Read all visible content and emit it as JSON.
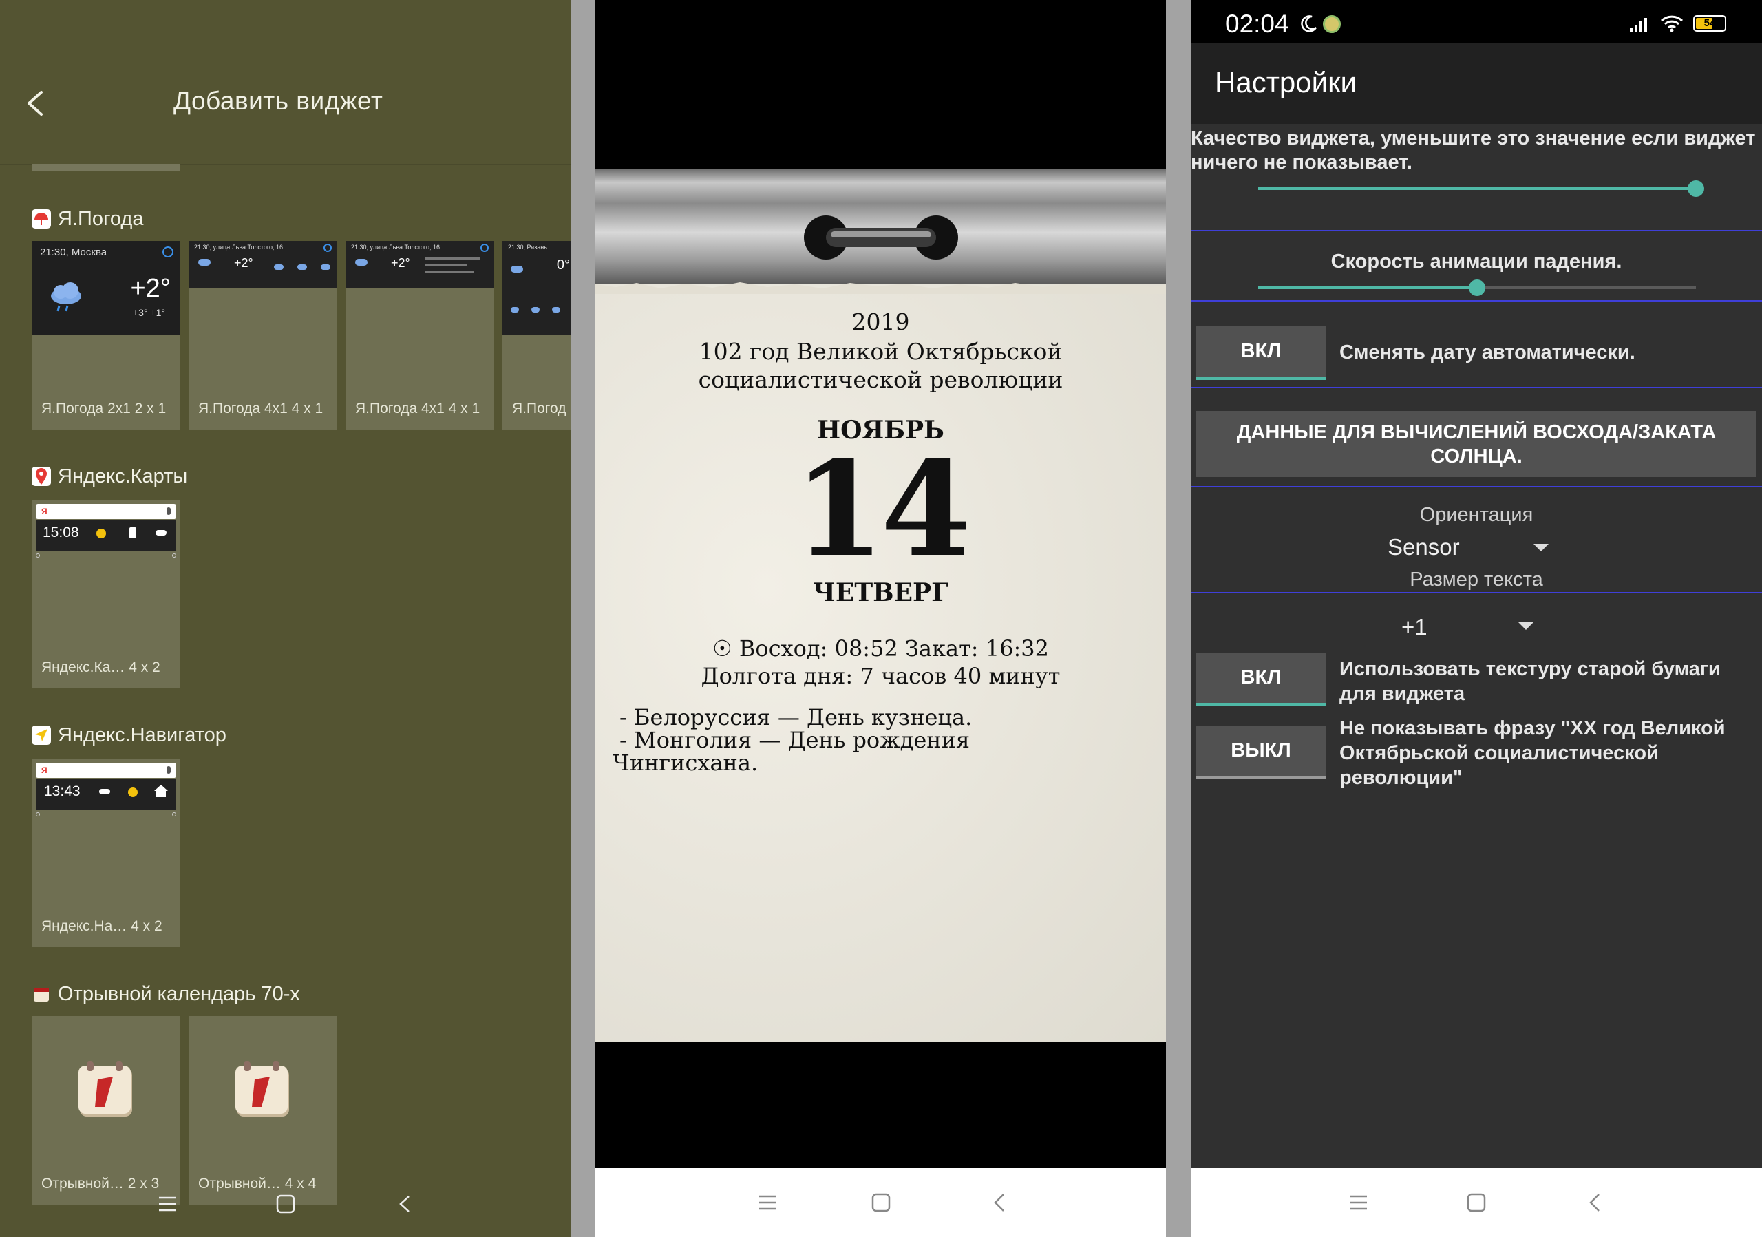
{
  "widget_picker": {
    "title": "Добавить виджет",
    "sections": [
      {
        "label": "Я.Погода",
        "cards": [
          {
            "caption": "Я.Погода 2x1 2 x 1",
            "header": "21:30, Москва",
            "temp": "+2°",
            "minmax": "+3° +1°"
          },
          {
            "caption": "Я.Погода 4x1 4 x 1",
            "header": "21:30, улица Льва Толстого, 16",
            "temp": "+2°"
          },
          {
            "caption": "Я.Погода 4x1 4 x 1",
            "header": "21:30, улица Льва Толстого, 16",
            "temp": "+2°"
          },
          {
            "caption": "Я.Погод",
            "header": "21:30, Рязань",
            "temp": "0°"
          }
        ]
      },
      {
        "label": "Яндекс.Карты",
        "cards": [
          {
            "caption": "Яндекс.Ка… 4 x 2",
            "time": "15:08"
          }
        ]
      },
      {
        "label": "Яндекс.Навигатор",
        "cards": [
          {
            "caption": "Яндекс.На… 4 x 2",
            "time": "13:43"
          }
        ]
      },
      {
        "label": "Отрывной календарь 70-х",
        "cards": [
          {
            "caption": "Отрывной… 2 x 3"
          },
          {
            "caption": "Отрывной… 4 x 4"
          }
        ]
      }
    ]
  },
  "calendar": {
    "year": "2019",
    "revolution_line1": "102 год Великой Октябрьской",
    "revolution_line2": "социалистической революции",
    "month": "НОЯБРЬ",
    "day": "14",
    "weekday": "ЧЕТВЕРГ",
    "sun_line": "☉ Восход: 08:52 Закат: 16:32",
    "daylength_line": "Долгота дня: 7 часов 40 минут",
    "holidays_line1": "-  Белоруссия — День кузнеца.",
    "holidays_line2": "-  Монголия — День рождения",
    "holidays_line3": "Чингисхана."
  },
  "settings": {
    "status_time": "02:04",
    "battery": "54",
    "title": "Настройки",
    "quality_label": "Качество виджета, уменьшите это значение если виджет ничего не показывает.",
    "quality_value": 1.0,
    "speed_label": "Скорость анимации падения.",
    "speed_value": 0.5,
    "auto_date_toggle": "ВКЛ",
    "auto_date_label": "Сменять дату автоматически.",
    "sun_data_button": "ДАННЫЕ ДЛЯ ВЫЧИСЛЕНИЙ ВОСХОДА/ЗАКАТА СОЛНЦА.",
    "orientation_label": "Ориентация",
    "orientation_value": "Sensor",
    "text_size_label": "Размер текста",
    "text_size_value": "+1",
    "texture_toggle": "ВКЛ",
    "texture_label": "Использовать текстуру старой бумаги для виджета",
    "phrase_toggle": "ВЫКЛ",
    "phrase_label": "Не показывать фразу \"XX год Великой Октябрьской социалистической революции\""
  },
  "colors": {
    "picker_bg": "#545432",
    "settings_bg": "#303030",
    "accent_teal": "#4fb8a6",
    "divider_blue": "#3f3fd8"
  }
}
